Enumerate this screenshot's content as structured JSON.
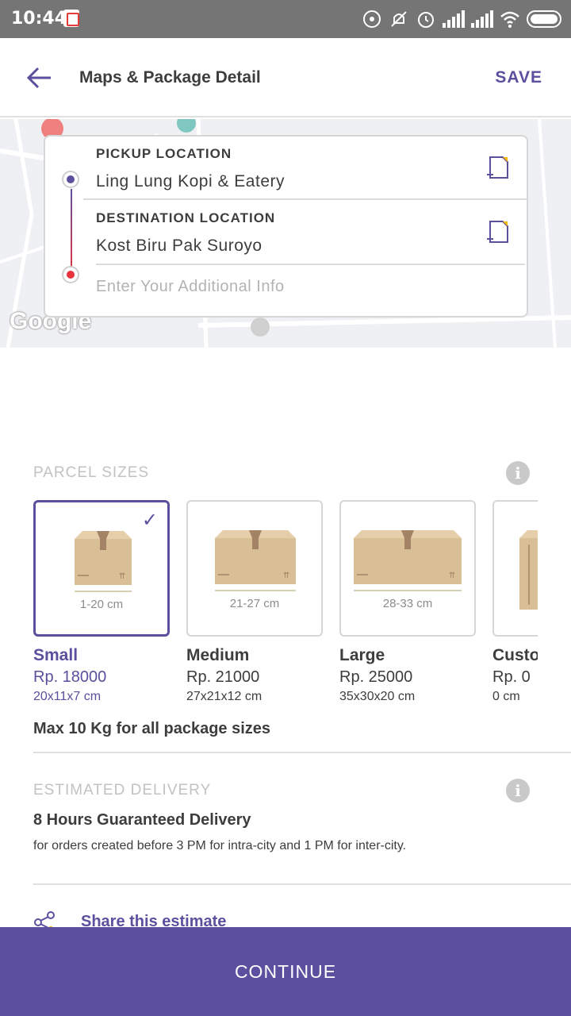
{
  "status_bar": {
    "time": "10:44"
  },
  "header": {
    "title": "Maps & Package Detail",
    "save_label": "SAVE"
  },
  "map": {
    "watermark": "Google"
  },
  "locations": {
    "pickup_label": "PICKUP LOCATION",
    "pickup_value": "Ling Lung Kopi & Eatery",
    "destination_label": "DESTINATION LOCATION",
    "destination_value": "Kost Biru Pak Suroyo",
    "additional_placeholder": "Enter Your Additional Info"
  },
  "parcel": {
    "section_title": "PARCEL SIZES",
    "sizes": [
      {
        "name": "Small",
        "price": "Rp. 18000",
        "dims": "20x11x7 cm",
        "range": "1-20 cm",
        "selected": true
      },
      {
        "name": "Medium",
        "price": "Rp. 21000",
        "dims": "27x21x12 cm",
        "range": "21-27 cm",
        "selected": false
      },
      {
        "name": "Large",
        "price": "Rp. 25000",
        "dims": "35x30x20 cm",
        "range": "28-33 cm",
        "selected": false
      },
      {
        "name": "Custom",
        "price": "Rp. 0",
        "dims": "0 cm",
        "range": "",
        "selected": false
      }
    ],
    "max_weight": "Max 10 Kg for all package sizes"
  },
  "delivery": {
    "section_title": "ESTIMATED DELIVERY",
    "headline": "8 Hours Guaranteed Delivery",
    "note": "for orders created before 3 PM for intra-city and 1 PM for inter-city."
  },
  "share_label": "Share this estimate",
  "continue_label": "CONTINUE",
  "colors": {
    "accent": "#5b4f9e",
    "destination": "#e8333d",
    "box": "#d9bf96"
  }
}
